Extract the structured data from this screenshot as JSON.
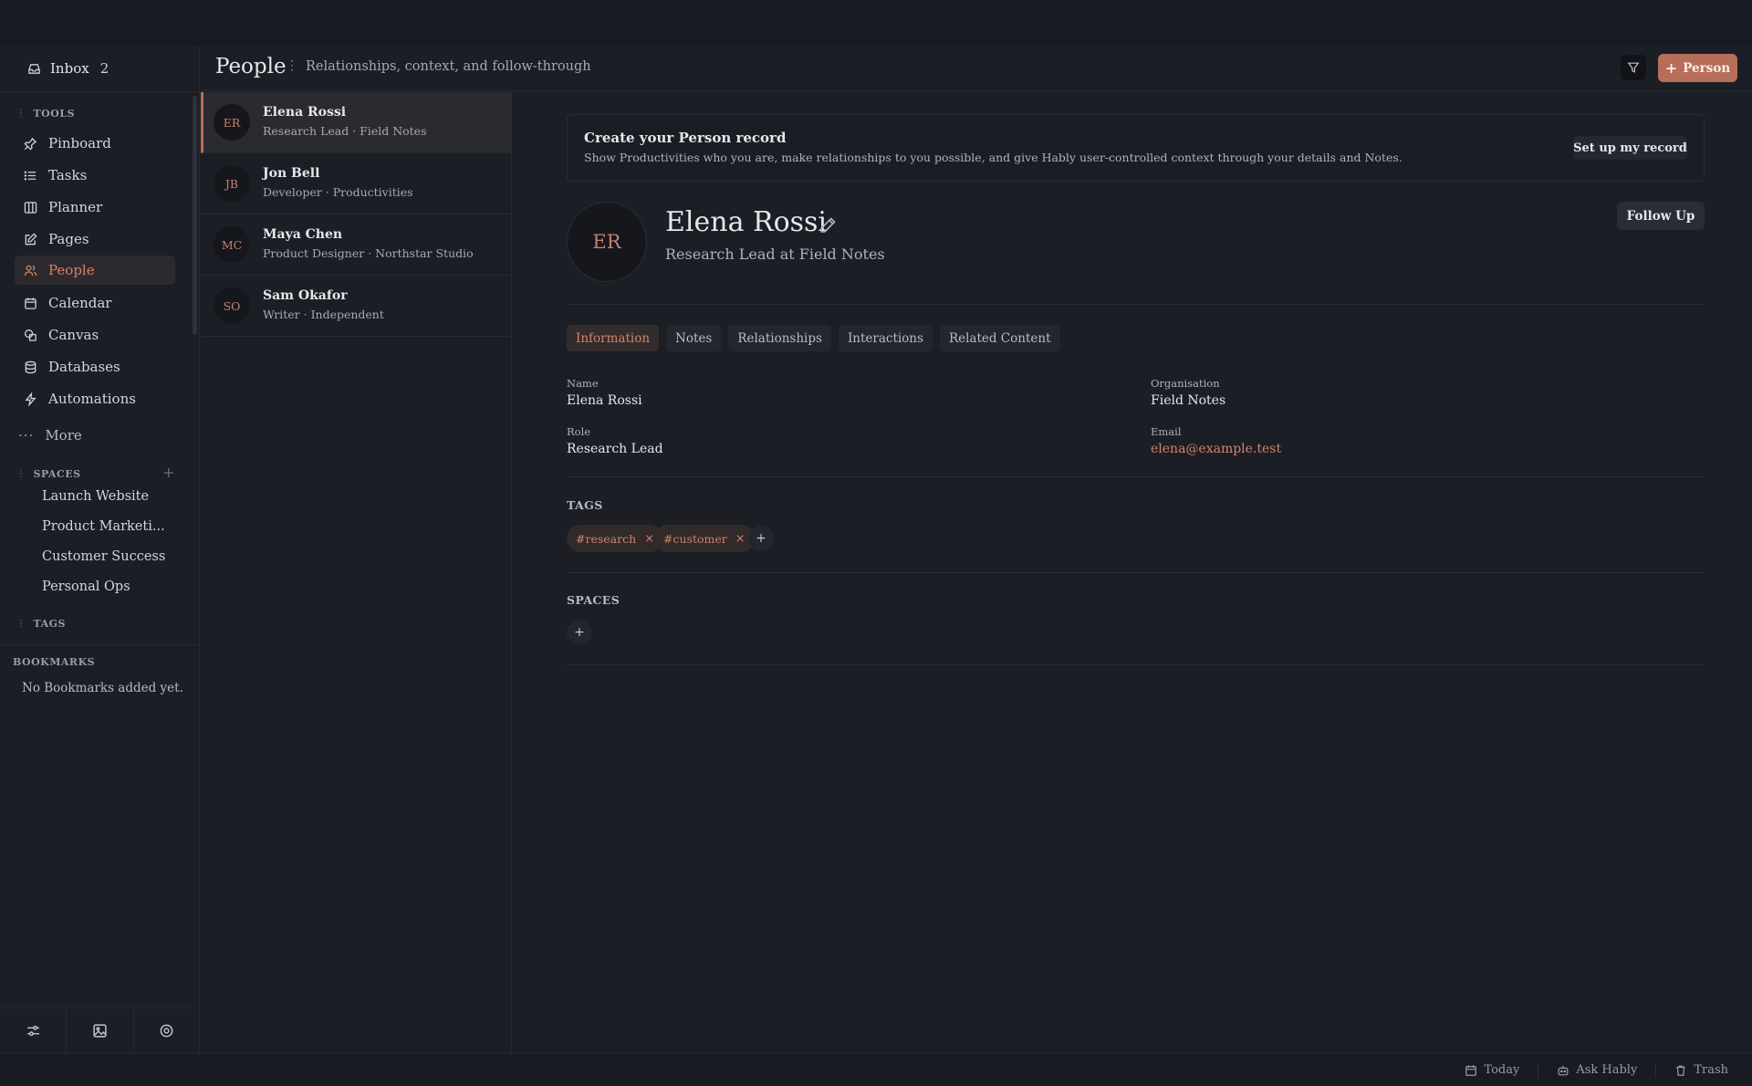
{
  "sidebar": {
    "inbox_label": "Inbox",
    "inbox_count": "2",
    "tools_label": "TOOLS",
    "items": [
      {
        "label": "Pinboard",
        "icon": "pin-icon"
      },
      {
        "label": "Tasks",
        "icon": "list-icon"
      },
      {
        "label": "Planner",
        "icon": "kanban-icon"
      },
      {
        "label": "Pages",
        "icon": "edit-page-icon"
      },
      {
        "label": "People",
        "icon": "people-icon"
      },
      {
        "label": "Calendar",
        "icon": "calendar-icon"
      },
      {
        "label": "Canvas",
        "icon": "canvas-icon"
      },
      {
        "label": "Databases",
        "icon": "database-icon"
      },
      {
        "label": "Automations",
        "icon": "lightning-icon"
      }
    ],
    "more_label": "More",
    "spaces_label": "SPACES",
    "spaces": [
      "Launch Website",
      "Product Marketi...",
      "Customer Success",
      "Personal Ops"
    ],
    "tags_label": "TAGS",
    "bookmarks_label": "BOOKMARKS",
    "bookmarks_empty": "No Bookmarks added yet."
  },
  "header": {
    "title": "People",
    "subtitle": "Relationships, context, and follow-through",
    "add_label": "Person"
  },
  "people": [
    {
      "initials": "ER",
      "name": "Elena Rossi",
      "meta": "Research Lead · Field Notes"
    },
    {
      "initials": "JB",
      "name": "Jon Bell",
      "meta": "Developer · Productivities"
    },
    {
      "initials": "MC",
      "name": "Maya Chen",
      "meta": "Product Designer · Northstar Studio"
    },
    {
      "initials": "SO",
      "name": "Sam Okafor",
      "meta": "Writer · Independent"
    }
  ],
  "banner": {
    "title": "Create your Person record",
    "text": "Show Productivities who you are, make relationships to you possible, and give Hably user-controlled context through your details and Notes.",
    "button": "Set up my record"
  },
  "detail": {
    "initials": "ER",
    "name": "Elena Rossi",
    "role_line": "Research Lead at Field Notes",
    "follow_up": "Follow Up",
    "tabs": [
      "Information",
      "Notes",
      "Relationships",
      "Interactions",
      "Related Content"
    ],
    "fields": {
      "name_label": "Name",
      "name_value": "Elena Rossi",
      "org_label": "Organisation",
      "org_value": "Field Notes",
      "role_label": "Role",
      "role_value": "Research Lead",
      "email_label": "Email",
      "email_value": "elena@example.test"
    },
    "tags_title": "TAGS",
    "tags": [
      "#research",
      "#customer"
    ],
    "spaces_title": "SPACES"
  },
  "bottombar": {
    "today": "Today",
    "ask": "Ask Hably",
    "trash": "Trash"
  },
  "colors": {
    "accent": "#b76e58",
    "accent_text": "#d4836a",
    "background": "#1b1e25"
  }
}
